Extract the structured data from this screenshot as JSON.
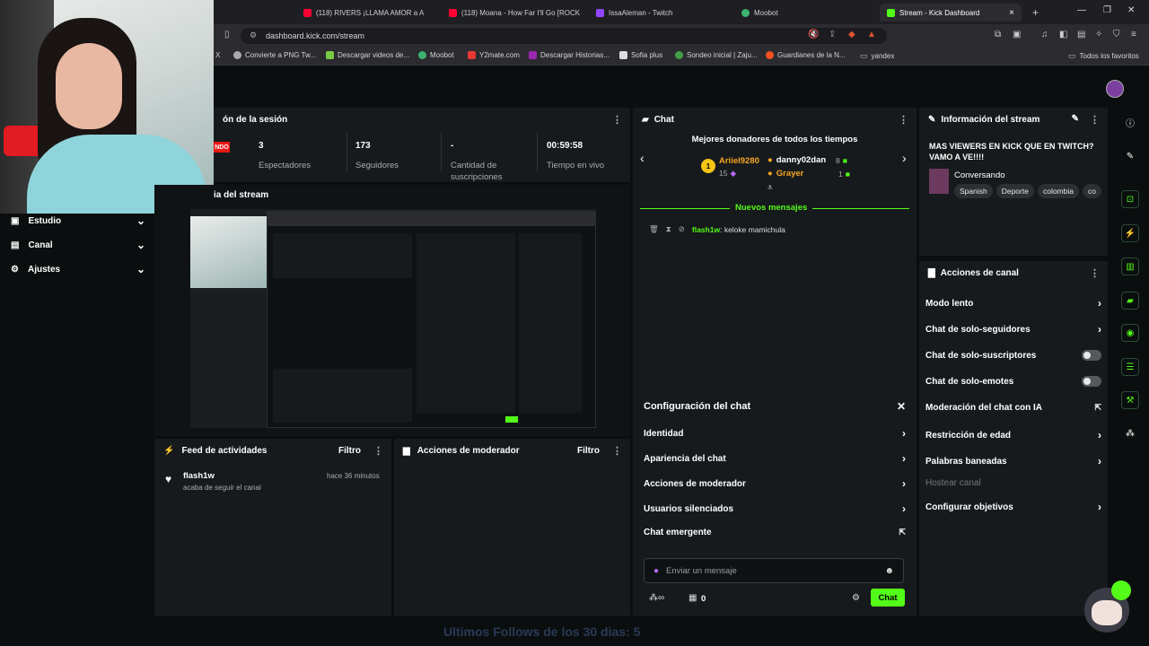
{
  "browser": {
    "tabs": [
      {
        "label": "(118) RIVERS ¡LLAMA AMOR a A",
        "color": "#ff0033"
      },
      {
        "label": "(118) Moana - How Far I'll Go [ROCK",
        "color": "#ff0033"
      },
      {
        "label": "IssaAleman - Twitch",
        "color": "#9146ff"
      },
      {
        "label": "Moobot",
        "color": "#3cb371"
      },
      {
        "label": "Stream - Kick Dashboard",
        "color": "#53fc18"
      }
    ],
    "url": "dashboard.kick.com/stream",
    "bookmarks": [
      {
        "label": "X",
        "color": "#888"
      },
      {
        "label": "Convierte a PNG Tw...",
        "color": "#aaa"
      },
      {
        "label": "Descargar videos de...",
        "color": "#7ac943"
      },
      {
        "label": "Moobot",
        "color": "#3cb371"
      },
      {
        "label": "Y2mate.com",
        "color": "#e53935"
      },
      {
        "label": "Descargar Historias...",
        "color": "#9c27b0"
      },
      {
        "label": "Sofia plus",
        "color": "#ddd"
      },
      {
        "label": "Sondeo inicial | Zaju...",
        "color": "#43a047"
      },
      {
        "label": "Guardianes de la N...",
        "color": "#f4511e"
      },
      {
        "label": "yandex",
        "color": "#bbb"
      },
      {
        "label": "Todos los favoritos",
        "color": "#bbb"
      }
    ]
  },
  "nav": {
    "items": [
      {
        "label": "Estudio",
        "icon": "video-icon"
      },
      {
        "label": "Canal",
        "icon": "tv-icon"
      },
      {
        "label": "Ajustes",
        "icon": "gear-icon"
      }
    ]
  },
  "session": {
    "title": "ón de la sesión",
    "live_badge": "NDO",
    "stats": [
      {
        "value": "3",
        "label": "Espectadores"
      },
      {
        "value": "173",
        "label": "Seguidores"
      },
      {
        "value": "-",
        "label": "Cantidad de suscripciones"
      },
      {
        "value": "00:59:58",
        "label": "Tiempo en vivo"
      }
    ]
  },
  "preview": {
    "title": "ia del stream"
  },
  "overlay_text": "Ultimos Follows de los 30 dias: 5",
  "activity": {
    "title": "Feed de actividades",
    "filter": "Filtro",
    "items": [
      {
        "user": "flash1w",
        "text": "acaba de seguir el canal",
        "time": "hace 36 minutos"
      }
    ]
  },
  "moderator": {
    "title": "Acciones de moderador",
    "filter": "Filtro"
  },
  "chat": {
    "title": "Chat",
    "donors_title": "Mejores donadores de todos los tiempos",
    "donors": [
      {
        "name": "Ariiel9280",
        "amount": "15",
        "rank": "1",
        "color": "#f5a623"
      },
      {
        "name": "danny02dan",
        "amount": "8",
        "color": "#ffffff"
      },
      {
        "name": "Grayer",
        "amount": "1",
        "color": "#f5a623"
      }
    ],
    "new_messages": "Nuevos mensajes",
    "messages": [
      {
        "user": "flash1w",
        "text": "keloke mamichula"
      }
    ],
    "settings": {
      "title": "Configuración del chat",
      "items": [
        "Identidad",
        "Apariencia del chat",
        "Acciones de moderador",
        "Usuarios silenciados",
        "Chat emergente"
      ]
    },
    "input_placeholder": "Enviar un mensaje",
    "count": "0",
    "send_label": "Chat"
  },
  "stream_info": {
    "title": "Información del stream",
    "stream_title": "MAS VIEWERS EN KICK QUE EN TWITCH? VAMO A VE!!!!",
    "category": "Conversando",
    "tags": [
      "Spanish",
      "Deporte",
      "colombia",
      "co"
    ]
  },
  "channel_actions": {
    "title": "Acciones de canal",
    "items": [
      {
        "label": "Modo lento",
        "control": "chevron"
      },
      {
        "label": "Chat de solo-seguidores",
        "control": "chevron"
      },
      {
        "label": "Chat de solo-suscriptores",
        "control": "toggle"
      },
      {
        "label": "Chat de solo-emotes",
        "control": "toggle"
      },
      {
        "label": "Moderación del chat con IA",
        "control": "external"
      },
      {
        "label": "Restricción de edad",
        "control": "chevron"
      },
      {
        "label": "Palabras baneadas",
        "control": "chevron"
      },
      {
        "label": "Hostear canal",
        "control": "none"
      },
      {
        "label": "Configurar objetivos",
        "control": "chevron"
      }
    ]
  },
  "accent": "#53fc18"
}
